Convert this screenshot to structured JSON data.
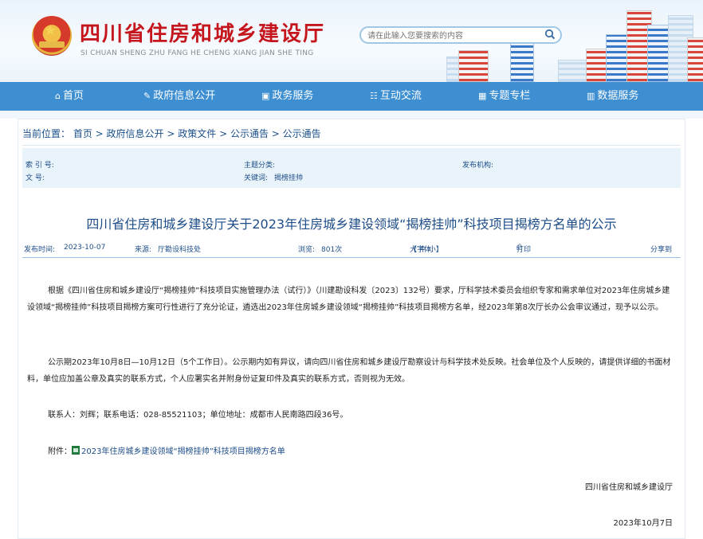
{
  "header": {
    "title": "四川省住房和城乡建设厅",
    "pinyin": "SI CHUAN SHENG ZHU FANG HE CHENG XIANG JIAN SHE TING",
    "search_placeholder": "请在此输入您要搜索的内容",
    "icons": {
      "search": "search-icon",
      "emblem": "national-emblem-icon"
    }
  },
  "nav": {
    "items": [
      {
        "label": "首页",
        "icon": "home-icon"
      },
      {
        "label": "政府信息公开",
        "icon": "edit-icon"
      },
      {
        "label": "政务服务",
        "icon": "service-icon"
      },
      {
        "label": "互动交流",
        "icon": "chat-icon"
      },
      {
        "label": "专题专栏",
        "icon": "grid-icon"
      },
      {
        "label": "数据服务",
        "icon": "data-icon"
      }
    ]
  },
  "breadcrumb": {
    "label": "当前位置：",
    "items": [
      "首页",
      "政府信息公开",
      "政策文件",
      "公示通告",
      "公示通告"
    ],
    "separator": " > "
  },
  "meta": {
    "index_label": "索 引 号:",
    "index_value": "",
    "topic_label": "主题分类:",
    "topic_value": "",
    "publisher_label": "发布机构:",
    "publisher_value": "",
    "docno_label": "文 号:",
    "docno_value": "",
    "keywords_label": "关键词:",
    "keywords_value": "揭榜挂帅"
  },
  "article": {
    "title": "四川省住房和城乡建设厅关于2023年住房城乡建设领域“揭榜挂帅”科技项目揭榜方名单的公示",
    "info": {
      "date_label": "发布时间:",
      "date": "2023-10-07",
      "source_label": "来源:",
      "source": "厅勘设科技处",
      "views_label": "浏览:",
      "views": "801次",
      "font_label": "【字体:",
      "font_large": "大",
      "font_medium": "中",
      "font_small": "小",
      "font_close": "】",
      "print": "打印",
      "share": "分享到"
    },
    "paragraphs": [
      "根据《四川省住房和城乡建设厅“揭榜挂帅”科技项目实施管理办法（试行）》（川建勘设科发〔2023〕132号）要求，厅科学技术委员会组织专家和需求单位对2023年住房城乡建设领域“揭榜挂帅”科技项目揭榜方案可行性进行了充分论证，遴选出2023年住房城乡建设领域“揭榜挂帅”科技项目揭榜方名单，经2023年第8次厅长办公会审议通过，现予以公示。",
      "公示期2023年10月8日—10月12日（5个工作日）。公示期内如有异议，请向四川省住房和城乡建设厅勘察设计与科学技术处反映。社会单位及个人反映的，请提供详细的书面材料，单位应加盖公章及真实的联系方式，个人应署实名并附身份证复印件及真实的联系方式，否则视为无效。",
      "联系人：刘辉；联系电话：028-85521103；单位地址：成都市人民南路四段36号。"
    ],
    "attachment_label": "附件：",
    "attachment_name": "2023年住房城乡建设领域“揭榜挂帅”科技项目揭榜方名单",
    "signature": "四川省住房和城乡建设厅",
    "sign_date": "2023年10月7日"
  },
  "colors": {
    "brand_red": "#c4161c",
    "nav_blue": "#3d8fd1",
    "link_blue": "#1d4d88"
  }
}
